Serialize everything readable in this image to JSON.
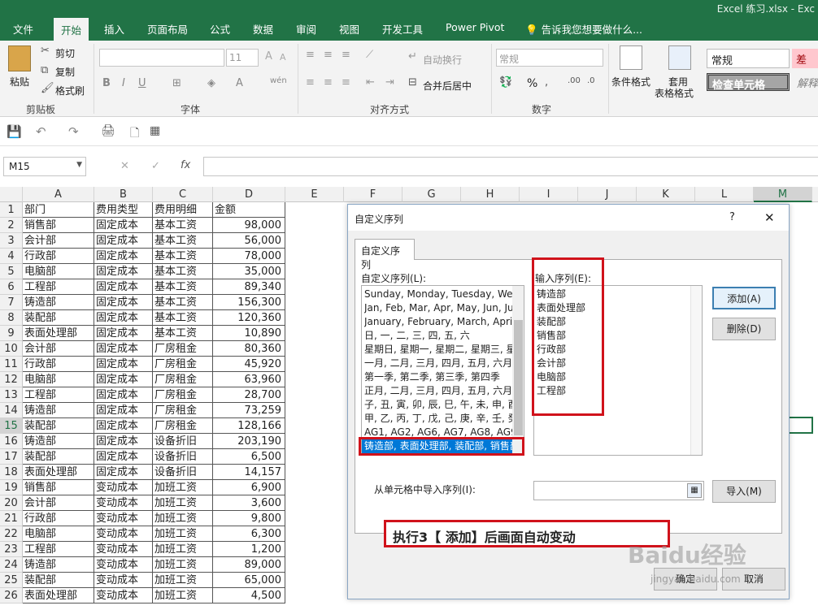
{
  "window": {
    "title": "Excel 练习.xlsx - Exc"
  },
  "tabs": [
    "文件",
    "开始",
    "插入",
    "页面布局",
    "公式",
    "数据",
    "审阅",
    "视图",
    "开发工具",
    "Power Pivot"
  ],
  "tellme": "告诉我您想要做什么...",
  "ribbon": {
    "clipboard": {
      "paste": "粘贴",
      "cut": "剪切",
      "copy": "复制",
      "painter": "格式刷",
      "label": "剪贴板"
    },
    "font": {
      "size": "11",
      "label": "字体",
      "phonetic": "wén"
    },
    "align": {
      "wrap": "自动换行",
      "merge": "合并后居中",
      "label": "对齐方式"
    },
    "number": {
      "format": "常规",
      "label": "数字",
      "percent": "%"
    },
    "styles": {
      "cond": "条件格式",
      "table1": "套用",
      "table2": "表格格式",
      "normal": "常规",
      "bad": "差",
      "check": "检查单元格",
      "explain": "解释"
    }
  },
  "formula": {
    "name": "M15",
    "fx": "fx"
  },
  "columns": [
    "A",
    "B",
    "C",
    "D",
    "E",
    "F",
    "G",
    "H",
    "I",
    "J",
    "K",
    "L",
    "M"
  ],
  "rows": [
    [
      "部门",
      "费用类型",
      "费用明细",
      "金额"
    ],
    [
      "销售部",
      "固定成本",
      "基本工资",
      "98,000"
    ],
    [
      "会计部",
      "固定成本",
      "基本工资",
      "56,000"
    ],
    [
      "行政部",
      "固定成本",
      "基本工资",
      "78,000"
    ],
    [
      "电脑部",
      "固定成本",
      "基本工资",
      "35,000"
    ],
    [
      "工程部",
      "固定成本",
      "基本工资",
      "89,340"
    ],
    [
      "铸造部",
      "固定成本",
      "基本工资",
      "156,300"
    ],
    [
      "装配部",
      "固定成本",
      "基本工资",
      "120,360"
    ],
    [
      "表面处理部",
      "固定成本",
      "基本工资",
      "10,890"
    ],
    [
      "会计部",
      "固定成本",
      "厂房租金",
      "80,360"
    ],
    [
      "行政部",
      "固定成本",
      "厂房租金",
      "45,920"
    ],
    [
      "电脑部",
      "固定成本",
      "厂房租金",
      "63,960"
    ],
    [
      "工程部",
      "固定成本",
      "厂房租金",
      "28,700"
    ],
    [
      "铸造部",
      "固定成本",
      "厂房租金",
      "73,259"
    ],
    [
      "装配部",
      "固定成本",
      "厂房租金",
      "128,166"
    ],
    [
      "铸造部",
      "固定成本",
      "设备折旧",
      "203,190"
    ],
    [
      "装配部",
      "固定成本",
      "设备折旧",
      "6,500"
    ],
    [
      "表面处理部",
      "固定成本",
      "设备折旧",
      "14,157"
    ],
    [
      "销售部",
      "变动成本",
      "加班工资",
      "6,900"
    ],
    [
      "会计部",
      "变动成本",
      "加班工资",
      "3,600"
    ],
    [
      "行政部",
      "变动成本",
      "加班工资",
      "9,800"
    ],
    [
      "电脑部",
      "变动成本",
      "加班工资",
      "6,300"
    ],
    [
      "工程部",
      "变动成本",
      "加班工资",
      "1,200"
    ],
    [
      "铸造部",
      "变动成本",
      "加班工资",
      "89,000"
    ],
    [
      "装配部",
      "变动成本",
      "加班工资",
      "65,000"
    ],
    [
      "表面处理部",
      "变动成本",
      "加班工资",
      "4,500"
    ]
  ],
  "dialog": {
    "title": "自定义序列",
    "help": "?",
    "close": "✕",
    "tab": "自定义序列",
    "list_label": "自定义序列(L):",
    "entries_label": "输入序列(E):",
    "lists": [
      "Sunday, Monday, Tuesday, Wed",
      "Jan, Feb, Mar, Apr, May, Jun, Ju",
      "January, February, March, April",
      "日, 一, 二, 三, 四, 五, 六",
      "星期日, 星期一, 星期二, 星期三, 星",
      "一月, 二月, 三月, 四月, 五月, 六月,",
      "第一季, 第二季, 第三季, 第四季",
      "正月, 二月, 三月, 四月, 五月, 六月,",
      "子, 丑, 寅, 卯, 辰, 巳, 午, 未, 申, 酉",
      "甲, 乙, 丙, 丁, 戊, 己, 庚, 辛, 壬, 癸",
      "AG1, AG2, AG6, AG7, AG8, AG9,"
    ],
    "selected": "铸造部, 表面处理部, 装配部, 销售部",
    "entries": [
      "铸造部",
      "表面处理部",
      "装配部",
      "销售部",
      "行政部",
      "会计部",
      "电脑部",
      "工程部"
    ],
    "add": "添加(A)",
    "delete": "删除(D)",
    "import_label": "从单元格中导入序列(I):",
    "import": "导入(M)",
    "ok": "确定",
    "cancel": "取消"
  },
  "annotation": "执行3【 添加】后画面自动变动",
  "watermark": {
    "brand": "Baidu经验",
    "url": "jingyan.baidu.com"
  }
}
